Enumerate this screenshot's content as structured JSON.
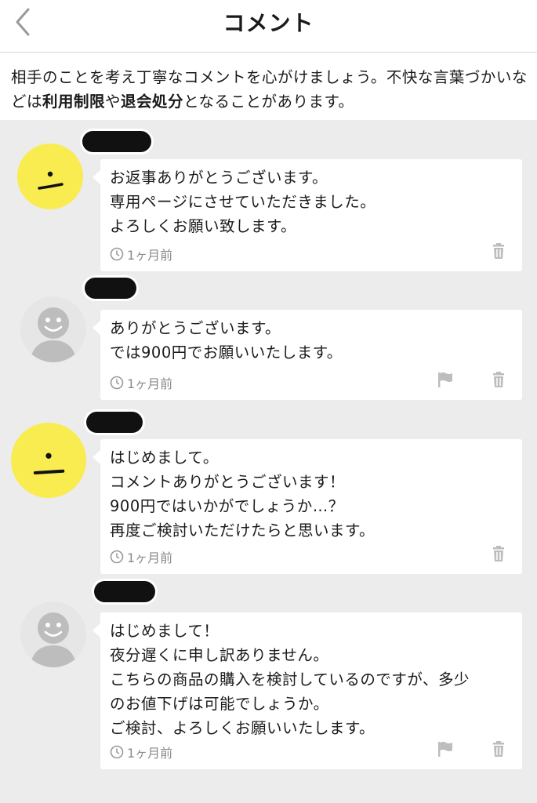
{
  "header": {
    "title": "コメント",
    "back_icon": "chevron-left-icon"
  },
  "notice": {
    "text_1": "相手のことを考え丁寧なコメントを心がけましょう。不快な言葉づかいなどは",
    "bold_1": "利用制限",
    "text_2": "や",
    "bold_2": "退会処分",
    "text_3": "となることがあります。"
  },
  "comments": [
    {
      "avatar": "smiley-face-icon",
      "text": "お返事ありがとうございます。\n専用ページにさせていただきました。\nよろしくお願い致します。",
      "time": "1ヶ月前",
      "actions": [
        "trash-icon"
      ]
    },
    {
      "avatar": "default-user-icon",
      "text": "ありがとうございます。\nでは900円でお願いいたします。",
      "time": "1ヶ月前",
      "actions": [
        "flag-icon",
        "trash-icon"
      ]
    },
    {
      "avatar": "smiley-face-icon",
      "text": "はじめまして。\nコメントありがとうございます！\n900円ではいかがでしょうか…？\n再度ご検討いただけたらと思います。",
      "time": "1ヶ月前",
      "actions": [
        "trash-icon"
      ]
    },
    {
      "avatar": "default-user-icon",
      "text": "はじめまして！\n夜分遅くに申し訳ありません。\nこちらの商品の購入を検討しているのですが、多少\nのお値下げは可能でしょうか。\nご検討、よろしくお願いいたします。",
      "time": "1ヶ月前",
      "actions": [
        "flag-icon",
        "trash-icon"
      ]
    }
  ],
  "colors": {
    "smiley_avatar": "#f8ec51",
    "default_avatar": "#e6e6e6",
    "page_background": "#ececec",
    "meta_gray": "#8a8a8a"
  }
}
